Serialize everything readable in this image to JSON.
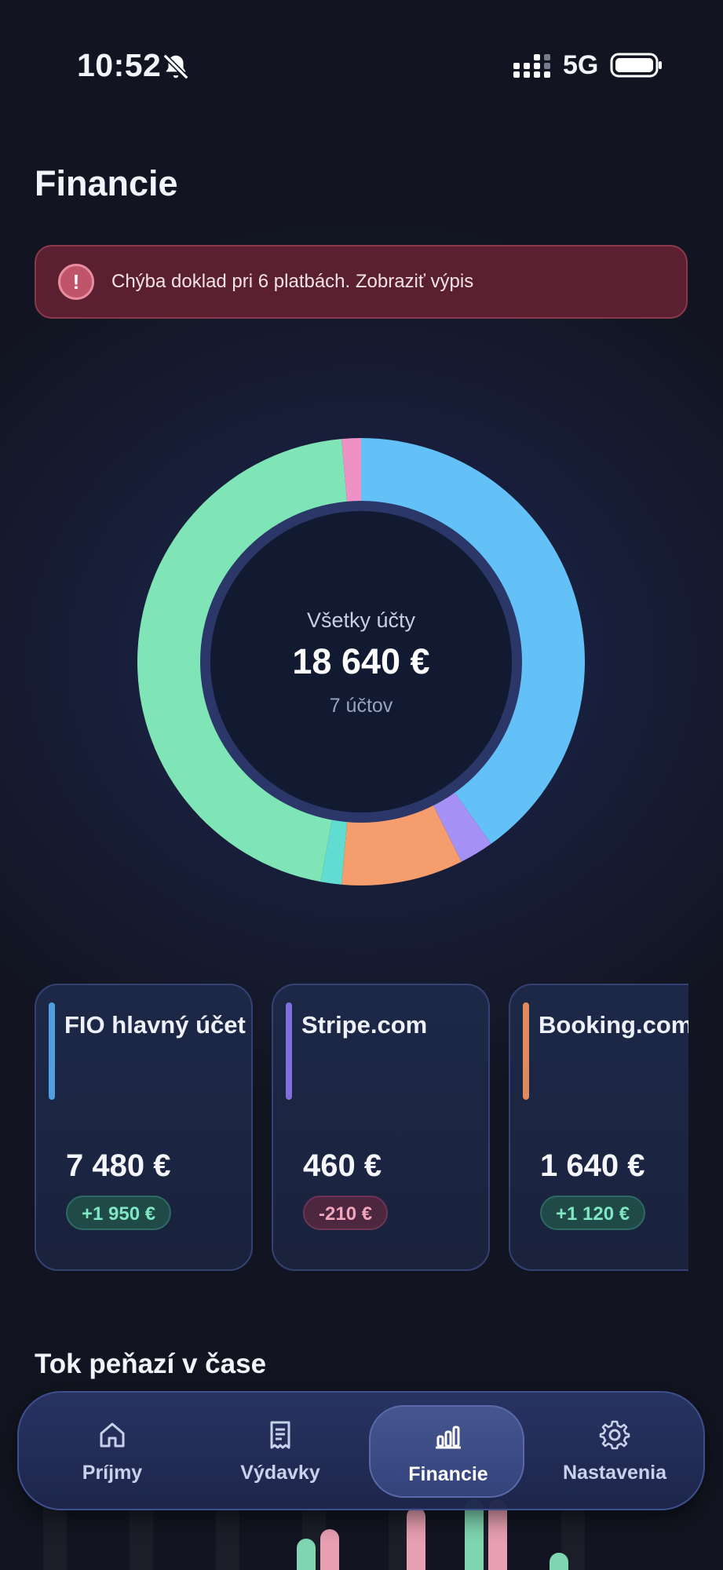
{
  "status_bar": {
    "time": "10:52",
    "network": "5G"
  },
  "page": {
    "title": "Financie"
  },
  "alert": {
    "text": "Chýba doklad pri 6 platbách. Zobraziť výpis",
    "icon": "exclamation-icon"
  },
  "donut": {
    "label": "Všetky účty",
    "total": "18 640 €",
    "subtitle": "7 účtov",
    "segments": [
      {
        "value": 7480,
        "color": "#63c1f7"
      },
      {
        "value": 460,
        "color": "#a590f5"
      },
      {
        "value": 1640,
        "color": "#f59d6c"
      },
      {
        "value": 280,
        "color": "#60dcd0"
      },
      {
        "value": 8520,
        "color": "#80e5b6"
      },
      {
        "value": 260,
        "color": "#ee91c4"
      }
    ]
  },
  "accounts": [
    {
      "name": "FIO hlavný účet",
      "amount": "7 480 €",
      "change": "+1 950 €",
      "trend": "positive",
      "color": "#4f9fe0"
    },
    {
      "name": "Stripe.com",
      "amount": "460 €",
      "change": "-210 €",
      "trend": "negative",
      "color": "#7f6fe0"
    },
    {
      "name": "Booking.com",
      "amount": "1 640 €",
      "change": "+1 120 €",
      "trend": "positive",
      "color": "#e08a5f"
    }
  ],
  "section": {
    "title": "Tok peňazí v čase"
  },
  "tabs": [
    {
      "label": "Príjmy",
      "icon": "home-icon"
    },
    {
      "label": "Výdavky",
      "icon": "receipt-icon"
    },
    {
      "label": "Financie",
      "icon": "bar-chart-icon",
      "active": true
    },
    {
      "label": "Nastavenia",
      "icon": "gear-icon"
    }
  ]
}
